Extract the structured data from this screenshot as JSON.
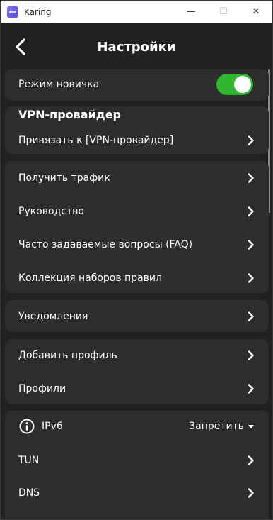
{
  "window": {
    "title": "Karing",
    "minimize": "—",
    "maximize": "☐",
    "close": "✕"
  },
  "header": {
    "title": "Настройки"
  },
  "novice": {
    "label": "Режим новичка",
    "enabled": true
  },
  "vpn": {
    "title": "VPN-провайдер",
    "bind_label": "Привязать к [VPN-провайдер]"
  },
  "links": {
    "traffic": "Получить трафик",
    "guide": "Руководство",
    "faq": "Часто задаваемые вопросы (FAQ)",
    "rules": "Коллекция наборов правил"
  },
  "notifications": {
    "label": "Уведомления"
  },
  "profiles": {
    "add": "Добавить профиль",
    "list": "Профили"
  },
  "network": {
    "ipv6_label": "IPv6",
    "ipv6_value": "Запретить",
    "tun": "TUN",
    "dns": "DNS"
  },
  "colors": {
    "accent_toggle": "#2fb52f",
    "card": "#2d2d2d",
    "background": "#212121"
  }
}
